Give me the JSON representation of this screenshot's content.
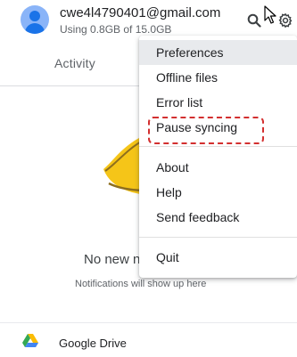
{
  "account": {
    "email": "cwe4l4790401@gmail.com",
    "usage": "Using 0.8GB of 15.0GB"
  },
  "tabs": {
    "activity": "Activity"
  },
  "empty_state": {
    "title": "No new n",
    "subtitle": "Notifications will show up here"
  },
  "footer": {
    "app_name": "Google Drive"
  },
  "menu": {
    "items": [
      {
        "label": "Preferences",
        "selected": true
      },
      {
        "label": "Offline files"
      },
      {
        "label": "Error list"
      },
      {
        "label": "Pause syncing",
        "highlighted": true
      },
      {
        "label": "About"
      },
      {
        "label": "Help"
      },
      {
        "label": "Send feedback"
      },
      {
        "label": "Quit"
      }
    ]
  },
  "colors": {
    "highlight_dashed": "#d32f2f",
    "avatar": "#8ab4f8",
    "illustration": "#f5c518"
  },
  "icons": {
    "search": "search-icon",
    "settings": "gear-icon",
    "cursor": "mouse-pointer-icon",
    "drive": "google-drive-logo"
  }
}
